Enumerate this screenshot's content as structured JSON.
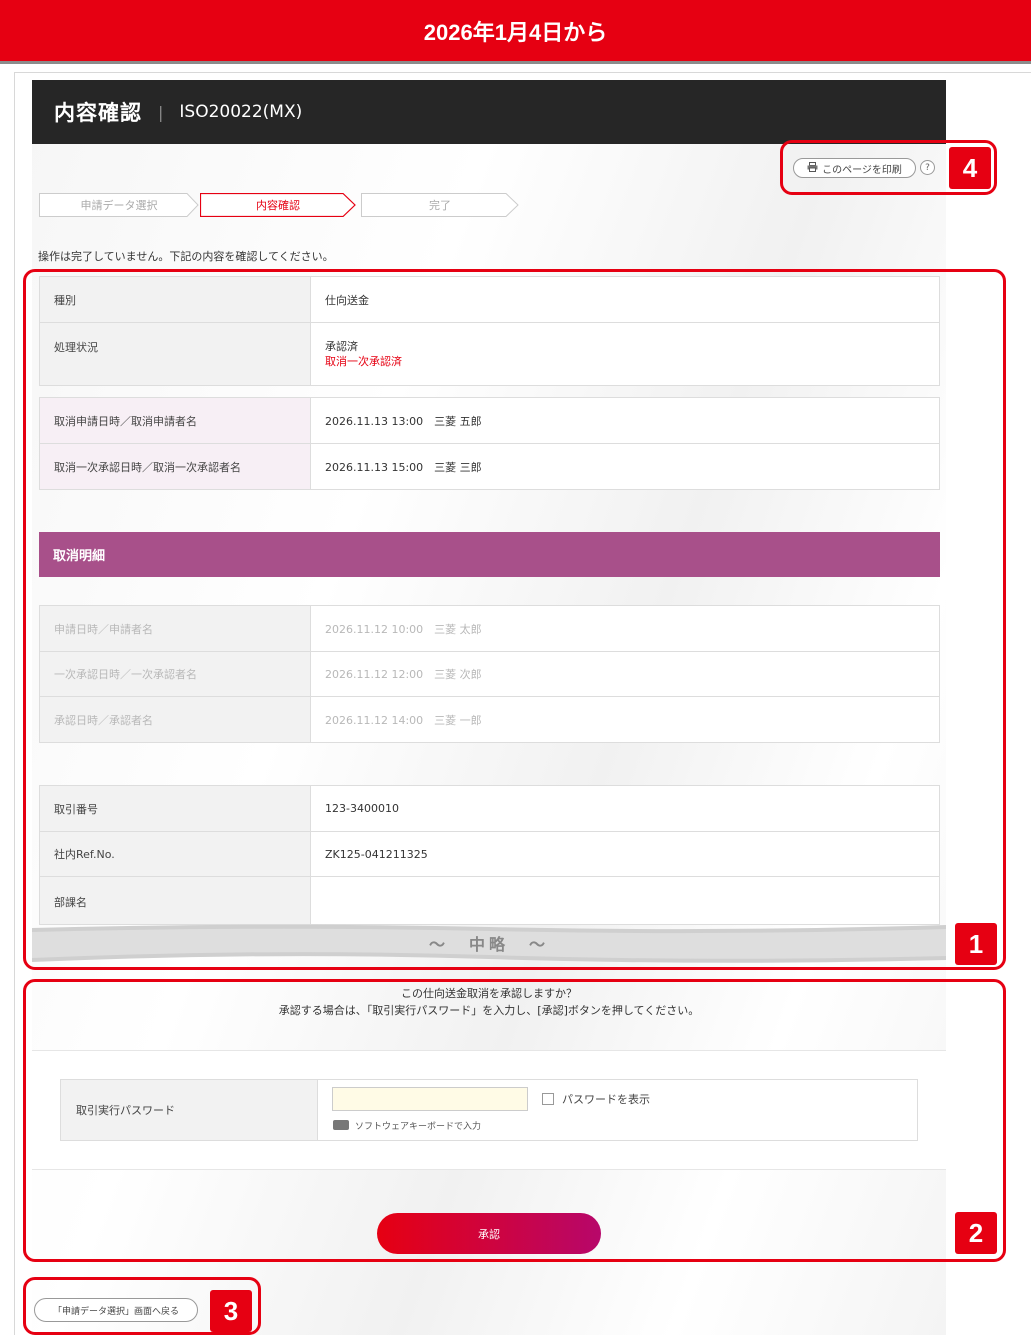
{
  "banner": {
    "text": "2026年1月4日から"
  },
  "header": {
    "title": "内容確認",
    "separator": "|",
    "subtitle": "ISO20022(MX)"
  },
  "toolbar": {
    "print_label": "このページを印刷",
    "help_label": "?"
  },
  "steps": [
    {
      "label": "申請データ選択",
      "state": "done"
    },
    {
      "label": "内容確認",
      "state": "active"
    },
    {
      "label": "完了",
      "state": "pending"
    }
  ],
  "notice": "操作は完了していません。下記の内容を確認してください。",
  "status_table": [
    {
      "label": "種別",
      "value": "仕向送金"
    },
    {
      "label": "処理状況",
      "value": "承認済",
      "value2": "取消一次承認済"
    }
  ],
  "cancel_table": [
    {
      "label": "取消申請日時／取消申請者名",
      "value": "2026.11.13 13:00　三菱 五郎"
    },
    {
      "label": "取消一次承認日時／取消一次承認者名",
      "value": "2026.11.13 15:00　三菱 三郎"
    }
  ],
  "cancel_section": {
    "title": "取消明細"
  },
  "history_table": [
    {
      "label": "申請日時／申請者名",
      "value": "2026.11.12 10:00　三菱 太郎"
    },
    {
      "label": "一次承認日時／一次承認者名",
      "value": "2026.11.12 12:00　三菱 次郎"
    },
    {
      "label": "承認日時／承認者名",
      "value": "2026.11.12 14:00　三菱 一郎"
    }
  ],
  "detail_table": [
    {
      "label": "取引番号",
      "value": "123-3400010"
    },
    {
      "label": "社内Ref.No.",
      "value": "ZK125-041211325"
    },
    {
      "label": "部課名",
      "value": ""
    }
  ],
  "omitted": "～　中略　～",
  "confirm": {
    "question": "この仕向送金取消を承認しますか？",
    "instruction": "承認する場合は、「取引実行パスワード」を入力し、[承認]ボタンを押してください。"
  },
  "password": {
    "label": "取引実行パスワード",
    "value": "",
    "show_label": "パスワードを表示",
    "keyboard_label": "ソフトウェアキーボードで入力"
  },
  "approve_label": "承認",
  "back_label": "「申請データ選択」画面へ戻る",
  "callouts": [
    "1",
    "2",
    "3",
    "4"
  ],
  "colors": {
    "brand_red": "#e60012",
    "section_purple": "#a8508a",
    "titlebar": "#262626"
  }
}
